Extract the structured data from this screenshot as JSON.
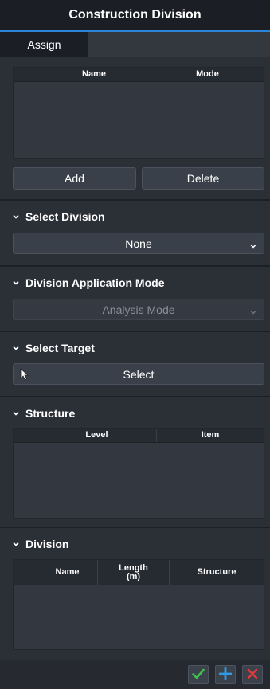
{
  "window": {
    "title": "Construction Division"
  },
  "tabs": [
    {
      "label": "Assign"
    }
  ],
  "assign_table": {
    "columns": [
      "",
      "Name",
      "Mode"
    ],
    "rows": []
  },
  "buttons": {
    "add": "Add",
    "delete": "Delete"
  },
  "select_division": {
    "title": "Select Division",
    "value": "None"
  },
  "application_mode": {
    "title": "Division Application Mode",
    "value": "Analysis Mode",
    "disabled": true
  },
  "select_target": {
    "title": "Select Target",
    "button": "Select"
  },
  "structure": {
    "title": "Structure",
    "columns": [
      "",
      "Level",
      "Item"
    ],
    "rows": []
  },
  "division": {
    "title": "Division",
    "columns": [
      "",
      "Name",
      "Length\n(m)",
      "Structure"
    ],
    "rows": []
  },
  "footer": {
    "icons": [
      "check-icon",
      "plus-icon",
      "close-icon"
    ],
    "colors": {
      "check": "#3fc04a",
      "plus": "#2e9be6",
      "close": "#e2383a"
    }
  }
}
